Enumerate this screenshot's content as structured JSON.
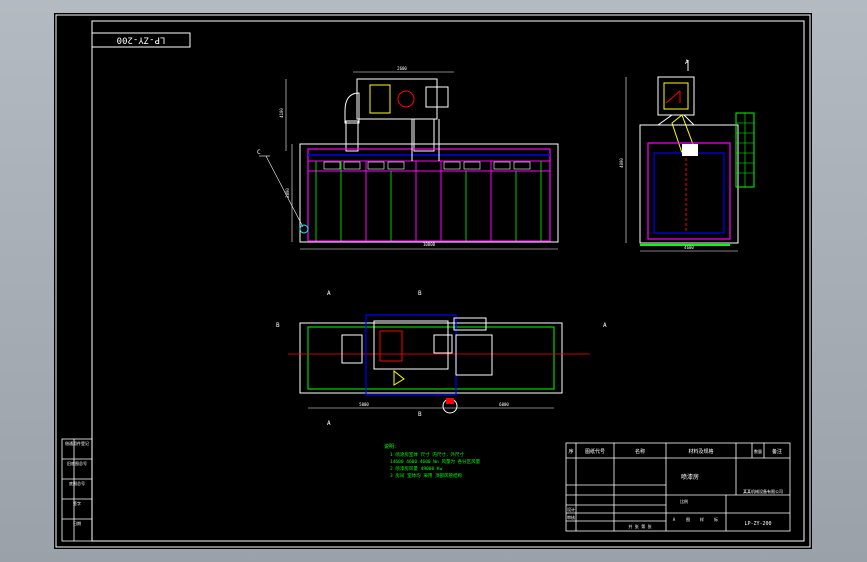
{
  "drawing": {
    "code_stamp": "LP-ZY-200",
    "code_bottom": "LP-ZY-200",
    "section_labels": {
      "a": "A",
      "b": "B",
      "c": "C"
    },
    "dims": {
      "top_height": "4100",
      "body_height": "2800",
      "total_length": "10800",
      "side_height": "4000",
      "side_width": "4600",
      "plan_left": "5000",
      "plan_right": "6000",
      "plan_mid": "2600"
    }
  },
  "notes": {
    "title": "说明：",
    "lines": [
      "1  喷涂房室体  尺寸 内尺寸，外尺寸  ",
      "   14600 4600 4600  Wn  风量为 各分区风量",
      "2  喷漆房风量 49000 Kw",
      "3  房间 室体均 采用  顶部风管结构"
    ]
  },
  "title_block": {
    "header_cells": [
      "序",
      "图纸代号",
      "名称",
      "材料及规格",
      "数量",
      "备注"
    ],
    "part_name": "喷漆房",
    "company": "某某机械设备有限公司",
    "drawing_no": "LP-ZY-200",
    "scale_label": "比例",
    "stage_labels": [
      "A",
      "图",
      "样",
      "标"
    ],
    "design_label": "设计",
    "check_label": "审核",
    "sheet_label": "共 张 第 张"
  },
  "revision_block": {
    "rows": [
      "借通用件登记",
      "旧底图总号",
      "底图总号",
      "签字",
      "日期"
    ]
  },
  "colors": {
    "background": "#000000",
    "outline": "#ffffff",
    "cabin_green": "#00ff00",
    "accent_magenta": "#ff00ff",
    "blue": "#0000ff",
    "red": "#ff0000",
    "yellow": "#ffff00",
    "cyan": "#00ffff"
  }
}
